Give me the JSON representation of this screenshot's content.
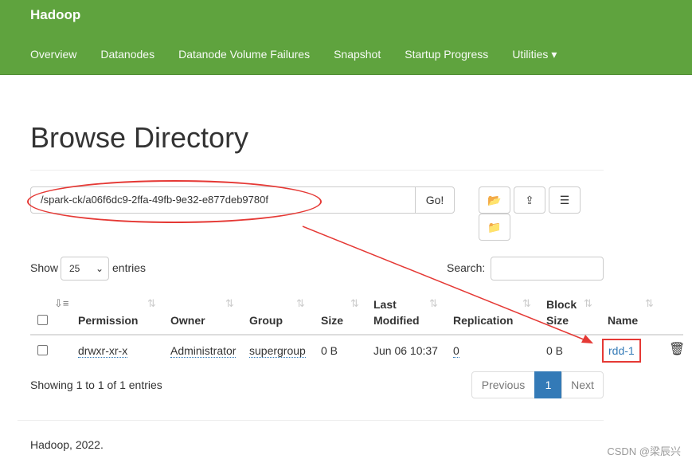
{
  "nav": {
    "brand": "Hadoop",
    "items": [
      "Overview",
      "Datanodes",
      "Datanode Volume Failures",
      "Snapshot",
      "Startup Progress",
      "Utilities ▾"
    ]
  },
  "page_title": "Browse Directory",
  "path_input": "/spark-ck/a06f6dc9-2ffa-49fb-9e32-e877deb9780f",
  "go_label": "Go!",
  "show_label": "Show",
  "entries_label": "entries",
  "page_size": "25",
  "search_label": "Search:",
  "columns": [
    "Permission",
    "Owner",
    "Group",
    "Size",
    "Last",
    "Modified",
    "Replication",
    "Block",
    "Size",
    "Name"
  ],
  "row": {
    "permission": "drwxr-xr-x",
    "owner": "Administrator",
    "group": "supergroup",
    "size": "0 B",
    "modified": "Jun 06 10:37",
    "replication": "0",
    "block_size": "0 B",
    "name": "rdd-1"
  },
  "info": "Showing 1 to 1 of 1 entries",
  "pagination": {
    "previous": "Previous",
    "current": "1",
    "next": "Next"
  },
  "footer": "Hadoop, 2022.",
  "watermark": "CSDN @梁辰兴",
  "annotation_color": "#e53935"
}
